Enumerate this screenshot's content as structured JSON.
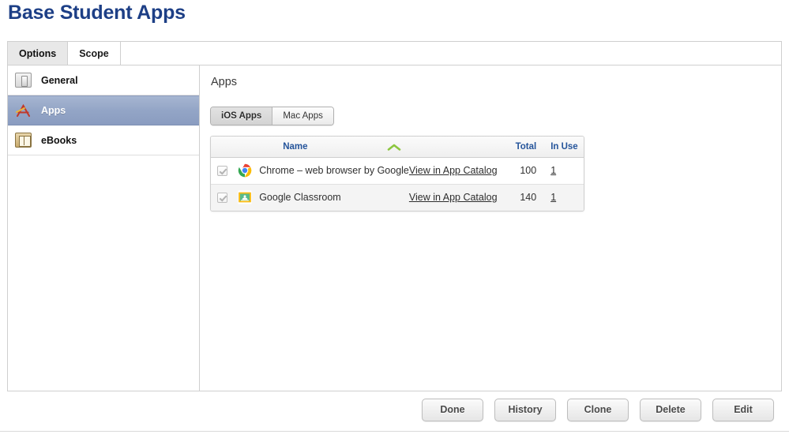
{
  "page_title": "Base Student Apps",
  "accent_color": "#1d3f86",
  "tabs": [
    {
      "label": "Options",
      "active": true
    },
    {
      "label": "Scope",
      "active": false
    }
  ],
  "sidebar": {
    "items": [
      {
        "label": "General",
        "icon": "switch-icon",
        "selected": false
      },
      {
        "label": "Apps",
        "icon": "app-store-icon",
        "selected": true
      },
      {
        "label": "eBooks",
        "icon": "book-icon",
        "selected": false
      }
    ]
  },
  "content": {
    "heading": "Apps",
    "segmented": [
      {
        "label": "iOS Apps",
        "active": true
      },
      {
        "label": "Mac Apps",
        "active": false
      }
    ],
    "table": {
      "columns": [
        "",
        "",
        "Name",
        "",
        "Total",
        "In Use"
      ],
      "headers": {
        "name": "Name",
        "total": "Total",
        "in_use": "In Use"
      },
      "sort": {
        "column": "Name",
        "direction": "ascending",
        "indicator_color": "#8cc63f"
      },
      "rows": [
        {
          "checked": true,
          "icon": "chrome-icon",
          "name": "Chrome – web browser by Google",
          "catalog_link": "View in App Catalog",
          "total": "100",
          "in_use": "1"
        },
        {
          "checked": true,
          "icon": "google-classroom-icon",
          "name": "Google Classroom",
          "catalog_link": "View in App Catalog",
          "total": "140",
          "in_use": "1"
        }
      ]
    }
  },
  "footer": {
    "buttons": [
      {
        "label": "Done"
      },
      {
        "label": "History"
      },
      {
        "label": "Clone"
      },
      {
        "label": "Delete"
      },
      {
        "label": "Edit"
      }
    ]
  }
}
